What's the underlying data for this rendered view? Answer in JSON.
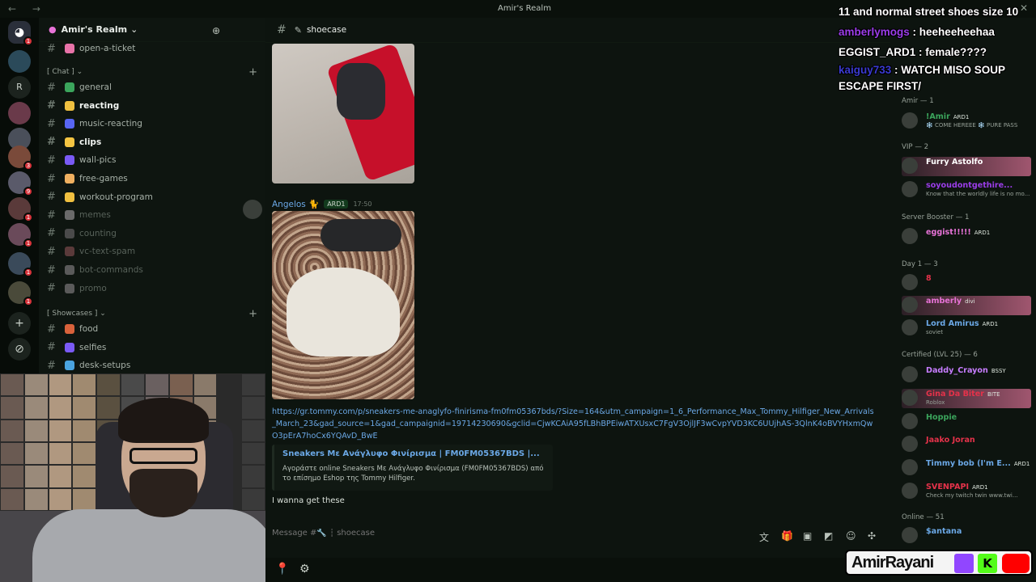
{
  "window": {
    "title": "Amir's Realm",
    "nav_arrows": "← →",
    "close": "✕"
  },
  "server": {
    "name": "Amir's Realm",
    "chevron": "⌄",
    "invite_icon": "person-add-icon"
  },
  "server_rail": {
    "badges": [
      "1",
      "3",
      "9",
      "1",
      "1",
      "1",
      "1"
    ],
    "letter": "R",
    "add_icon": "+",
    "discover_icon": "⊘"
  },
  "channel_list": {
    "top_channel": "open-a-ticket",
    "chat_category": "[ Chat ]",
    "chat_channels": [
      {
        "name": "general",
        "unread": false,
        "muted": false,
        "color": "#3ba55c"
      },
      {
        "name": "reacting",
        "unread": true,
        "muted": false,
        "color": "#f0c040"
      },
      {
        "name": "music-reacting",
        "unread": false,
        "muted": false,
        "color": "#5865f2"
      },
      {
        "name": "clips",
        "unread": true,
        "muted": false,
        "color": "#f5c542"
      },
      {
        "name": "wall-pics",
        "unread": false,
        "muted": false,
        "color": "#7a5af5"
      },
      {
        "name": "free-games",
        "unread": false,
        "muted": false,
        "color": "#f0b060"
      },
      {
        "name": "workout-program",
        "unread": false,
        "muted": false,
        "color": "#f0c040"
      },
      {
        "name": "memes",
        "unread": false,
        "muted": true,
        "color": "#6a6a6a"
      },
      {
        "name": "counting",
        "unread": false,
        "muted": true,
        "color": "#4a4a4a"
      },
      {
        "name": "vc-text-spam",
        "unread": false,
        "muted": true,
        "color": "#5a3a3a"
      },
      {
        "name": "bot-commands",
        "unread": false,
        "muted": true,
        "color": "#5a5a5a"
      },
      {
        "name": "promo",
        "unread": false,
        "muted": true,
        "color": "#5a5a5a"
      }
    ],
    "showcase_category": "[ Showcases ]",
    "showcase_channels": [
      {
        "name": "food",
        "color": "#d9623b"
      },
      {
        "name": "selfies",
        "color": "#7a5af5"
      },
      {
        "name": "desk-setups",
        "color": "#4aa3df"
      }
    ]
  },
  "chat": {
    "channel_name": "shoecase",
    "message": {
      "author": "Angelos 🐈",
      "tag": "ARD1",
      "time": "17:50",
      "link": "https://gr.tommy.com/p/sneakers-me-anaglyfo-finirisma-fm0fm05367bds/?Size=164&utm_campaign=1_6_Performance_Max_Tommy_Hilfiger_New_Arrivals_March_23&gad_source=1&gad_campaignid=19714230690&gclid=CjwKCAiA95fLBhBPEiwATXUsxC7FgV3OjlJF3wCvpYVD3KC6UUjhAS-3QlnK4oBVYHxmQwO3pErA7hoCx6YQAvD_BwE",
      "embed_title": "Sneakers Με Ανάγλυφο Φινίρισμα | FM0FM05367BDS |...",
      "embed_desc": "Αγοράστε online Sneakers Με Ανάγλυφο Φινίρισμα (FM0FM05367BDS) από το επίσημο Eshop της Tommy Hilfiger.",
      "text": "I wanna get these"
    },
    "composer_placeholder": "Message #🔧 ┆ shoecase"
  },
  "members": {
    "categories": [
      "Amir — 1",
      "VIP — 2",
      "Server Booster — 1",
      "Day 1 — 3",
      "Certified (LVL 25) — 6",
      "Online — 51"
    ],
    "list": [
      {
        "name": "!Amir",
        "tag": "ARD1",
        "sub": "❄️ COME HEREEE ❄️ PURE PASS",
        "color": "#3ba55c"
      },
      {
        "name": "Furry Astolfo",
        "tag": "",
        "sub": "",
        "color": "#ffffff"
      },
      {
        "name": "soyoudontgethire...",
        "tag": "",
        "sub": "Know that the worldly life is no mo...",
        "color": "#9b3de9"
      },
      {
        "name": "eggist!!!!!",
        "tag": "ARD1",
        "sub": "",
        "color": "#e873d8"
      },
      {
        "name": "8",
        "tag": "",
        "sub": "",
        "color": "#e5324a"
      },
      {
        "name": "amberly",
        "tag": "divi",
        "sub": "",
        "color": "#e873d8"
      },
      {
        "name": "Lord Amirus",
        "tag": "ARD1",
        "sub": "soviet",
        "color": "#6ba8e6"
      },
      {
        "name": "Daddy_Crayon",
        "tag": "BSSY",
        "sub": "",
        "color": "#c77dff"
      },
      {
        "name": "Gina Da Biter",
        "tag": "BITE",
        "sub": "Roblox",
        "color": "#e5324a"
      },
      {
        "name": "Hoppie",
        "tag": "",
        "sub": "",
        "color": "#3ba55c"
      },
      {
        "name": "Jaako Joran",
        "tag": "",
        "sub": "",
        "color": "#e5324a"
      },
      {
        "name": "Timmy bob (I'm E...",
        "tag": "ARD1",
        "sub": "",
        "color": "#6ba8e6"
      },
      {
        "name": "SVENPAPI",
        "tag": "ARD1",
        "sub": "Check my twitch twin www.twi...",
        "color": "#e5324a"
      },
      {
        "name": "$antana",
        "tag": "",
        "sub": "",
        "color": "#6ba8e6"
      }
    ]
  },
  "overlay": {
    "line1": "11 and normal street shoes size 10",
    "user1": "amberlymogs",
    "msg1": "heeheeheehaa",
    "line2": "EGGIST_ARD1 : female????",
    "user3": "kaiguy733",
    "msg3": "WATCH MISO SOUP ESCAPE FIRST/",
    "stream_name": "AmirRayani"
  }
}
